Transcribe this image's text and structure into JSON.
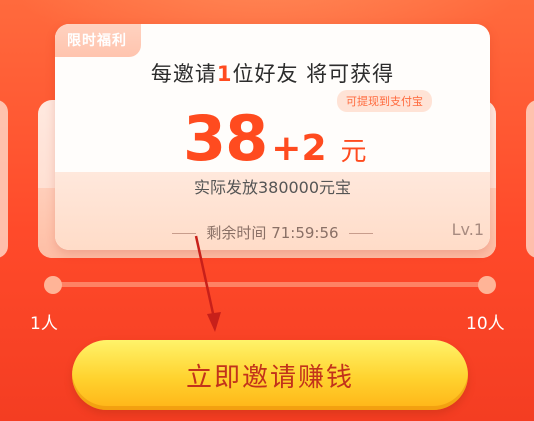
{
  "card": {
    "tag": "限时福利",
    "headline_pre": "每邀请",
    "headline_num": "1",
    "headline_post": "位好友 将可获得",
    "note_badge": "可提现到支付宝",
    "amount_main": "38",
    "amount_bonus": "+2",
    "amount_unit": "元",
    "actual_text": "实际发放380000元宝",
    "timer_label": "剩余时间",
    "timer_value": "71:59:56",
    "level": "Lv.1"
  },
  "slider": {
    "min_label": "1人",
    "max_label": "10人"
  },
  "cta": {
    "label": "立即邀请赚钱"
  },
  "colors": {
    "accent": "#ff4b1f",
    "background": "#ff4a2a",
    "cta_text": "#c2321b",
    "cta_fill": "#ffd22e"
  }
}
